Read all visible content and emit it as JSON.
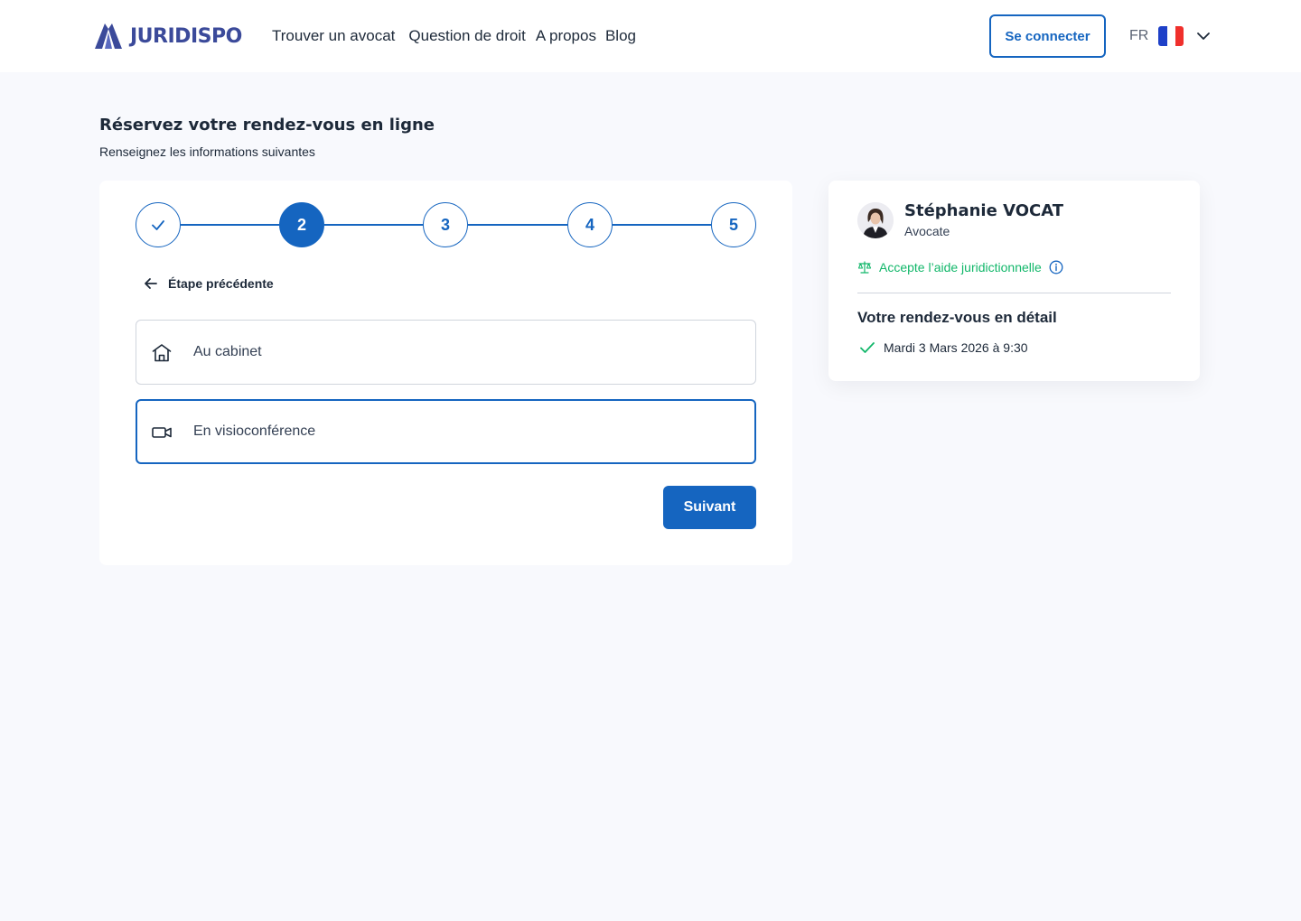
{
  "header": {
    "logo_text": "JURIDISPO",
    "nav": [
      "Trouver un avocat",
      "Question de droit",
      "A propos",
      "Blog"
    ],
    "login_label": "Se connecter",
    "language_code": "FR"
  },
  "page": {
    "title": "Réservez votre rendez-vous en ligne",
    "subtitle": "Renseignez les informations suivantes"
  },
  "stepper": {
    "steps": [
      "✓",
      "2",
      "3",
      "4",
      "5"
    ],
    "current": 2
  },
  "form": {
    "back_label": "Étape précédente",
    "options": [
      {
        "label": "Au cabinet",
        "icon": "house-icon",
        "selected": false
      },
      {
        "label": "En visioconférence",
        "icon": "video-camera-icon",
        "selected": true
      }
    ],
    "next_label": "Suivant"
  },
  "sidebar": {
    "lawyer_name": "Stéphanie VOCAT",
    "lawyer_role": "Avocate",
    "legal_aid": "Accepte l’aide juridictionnelle",
    "detail_title": "Votre rendez-vous en détail",
    "appointment": "Mardi 3 Mars 2026 à 9:30"
  },
  "colors": {
    "primary": "#1565c0",
    "logo": "#3b4a9a",
    "success": "#12b76a",
    "background": "#f8f9fd"
  }
}
